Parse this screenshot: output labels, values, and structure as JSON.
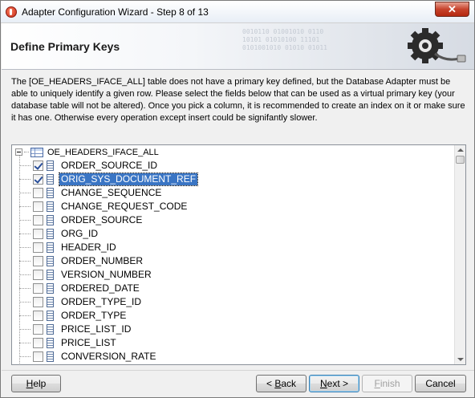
{
  "window": {
    "title": "Adapter Configuration Wizard - Step 8 of 13",
    "close_label": "✕"
  },
  "header": {
    "title": "Define Primary Keys",
    "binary_deco": [
      "0010110 01001010 0110",
      "10101 01010100 11101",
      "0101001010 01010 01011"
    ]
  },
  "description": "The [OE_HEADERS_IFACE_ALL] table does not have a primary key defined, but the Database Adapter must be able to uniquely identify a given row.  Please select the fields below that can be used as a virtual primary key (your database table will not be altered).  Once you pick a column, it is recommended to create an index on it or make sure it has one.  Otherwise every operation except insert could be signifantly slower.",
  "tree": {
    "root_label": "OE_HEADERS_IFACE_ALL",
    "columns": [
      {
        "label": "ORDER_SOURCE_ID",
        "checked": true,
        "selected": false
      },
      {
        "label": "ORIG_SYS_DOCUMENT_REF",
        "checked": true,
        "selected": true
      },
      {
        "label": "CHANGE_SEQUENCE",
        "checked": false,
        "selected": false
      },
      {
        "label": "CHANGE_REQUEST_CODE",
        "checked": false,
        "selected": false
      },
      {
        "label": "ORDER_SOURCE",
        "checked": false,
        "selected": false
      },
      {
        "label": "ORG_ID",
        "checked": false,
        "selected": false
      },
      {
        "label": "HEADER_ID",
        "checked": false,
        "selected": false
      },
      {
        "label": "ORDER_NUMBER",
        "checked": false,
        "selected": false
      },
      {
        "label": "VERSION_NUMBER",
        "checked": false,
        "selected": false
      },
      {
        "label": "ORDERED_DATE",
        "checked": false,
        "selected": false
      },
      {
        "label": "ORDER_TYPE_ID",
        "checked": false,
        "selected": false
      },
      {
        "label": "ORDER_TYPE",
        "checked": false,
        "selected": false
      },
      {
        "label": "PRICE_LIST_ID",
        "checked": false,
        "selected": false
      },
      {
        "label": "PRICE_LIST",
        "checked": false,
        "selected": false
      },
      {
        "label": "CONVERSION_RATE",
        "checked": false,
        "selected": false
      }
    ]
  },
  "buttons": {
    "help_accel": "H",
    "help_rest": "elp",
    "back_pre": "< ",
    "back_accel": "B",
    "back_rest": "ack",
    "next_accel": "N",
    "next_rest": "ext >",
    "finish_accel": "F",
    "finish_rest": "inish",
    "cancel": "Cancel"
  }
}
